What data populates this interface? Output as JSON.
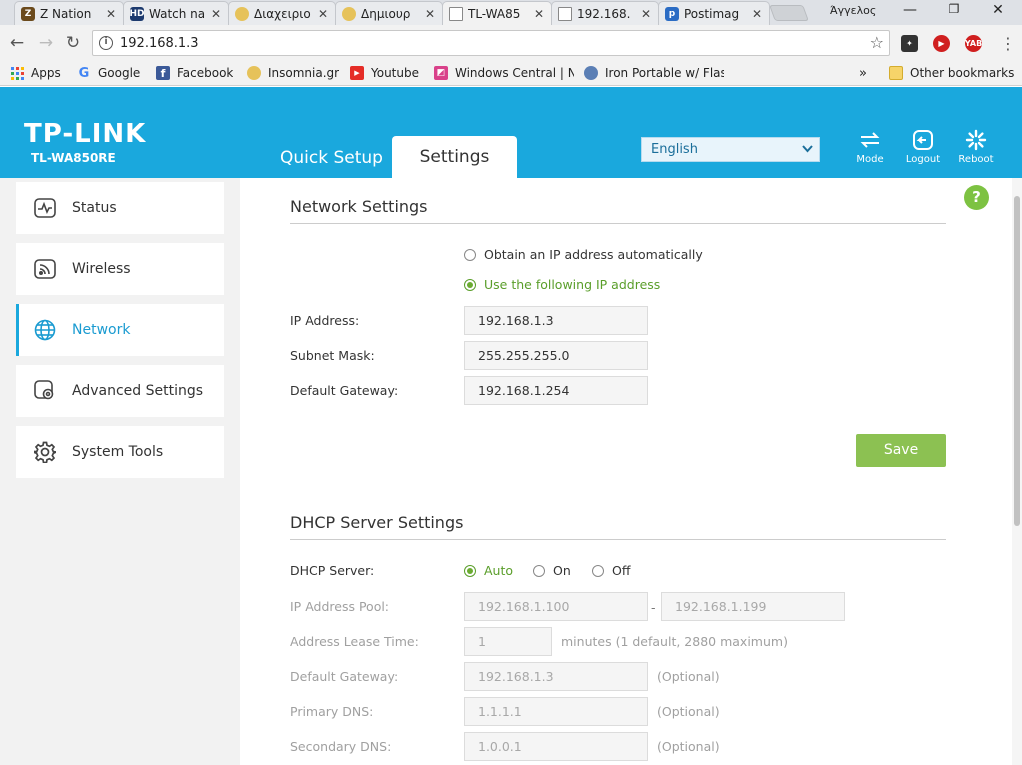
{
  "browser": {
    "tabs": [
      {
        "title": "Z Nation",
        "favicon_color": "#6b4a1c"
      },
      {
        "title": "Watch na",
        "favicon_color": "#1d3a6e"
      },
      {
        "title": "Διαχειριο",
        "favicon_color": "#e6c25a"
      },
      {
        "title": "Δημιουρ",
        "favicon_color": "#e6c25a"
      },
      {
        "title": "TL-WA85",
        "favicon_color": "#ffffff"
      },
      {
        "title": "192.168.",
        "favicon_color": "#ffffff"
      },
      {
        "title": "Postimag",
        "favicon_color": "#2b6cc4"
      }
    ],
    "profile_name": "Άγγελος",
    "url": "192.168.1.3",
    "bookmarks": [
      {
        "label": "Apps"
      },
      {
        "label": "Google"
      },
      {
        "label": "Facebook"
      },
      {
        "label": "Insomnia.gr"
      },
      {
        "label": "Youtube"
      },
      {
        "label": "Windows Central | N"
      },
      {
        "label": "Iron Portable w/ Flas"
      }
    ],
    "overflow_label": "»",
    "other_bookmarks": "Other bookmarks"
  },
  "header": {
    "logo": "TP-LINK",
    "model": "TL-WA850RE",
    "tabs": {
      "quick_setup": "Quick Setup",
      "settings": "Settings"
    },
    "language": "English",
    "buttons": {
      "mode": "Mode",
      "logout": "Logout",
      "reboot": "Reboot"
    },
    "accent_color": "#1aa8dd"
  },
  "sidebar": {
    "items": [
      {
        "label": "Status"
      },
      {
        "label": "Wireless"
      },
      {
        "label": "Network"
      },
      {
        "label": "Advanced Settings"
      },
      {
        "label": "System Tools"
      }
    ]
  },
  "help_label": "?",
  "network": {
    "title": "Network Settings",
    "option_auto": "Obtain an IP address automatically",
    "option_manual": "Use the following IP address",
    "selected_option": "manual",
    "ip_label": "IP Address:",
    "ip_value": "192.168.1.3",
    "mask_label": "Subnet Mask:",
    "mask_value": "255.255.255.0",
    "gateway_label": "Default Gateway:",
    "gateway_value": "192.168.1.254",
    "save_label": "Save"
  },
  "dhcp": {
    "title": "DHCP Server Settings",
    "server_label": "DHCP Server:",
    "mode_auto": "Auto",
    "mode_on": "On",
    "mode_off": "Off",
    "selected_mode": "auto",
    "pool_label": "IP Address Pool:",
    "pool_start": "192.168.1.100",
    "pool_separator": "-",
    "pool_end": "192.168.1.199",
    "lease_label": "Address Lease Time:",
    "lease_value": "1",
    "lease_hint": "minutes (1 default, 2880 maximum)",
    "gateway_label": "Default Gateway:",
    "gateway_value": "192.168.1.3",
    "primary_dns_label": "Primary DNS:",
    "primary_dns_value": "1.1.1.1",
    "secondary_dns_label": "Secondary DNS:",
    "secondary_dns_value": "1.0.0.1",
    "optional_hint": "(Optional)"
  }
}
